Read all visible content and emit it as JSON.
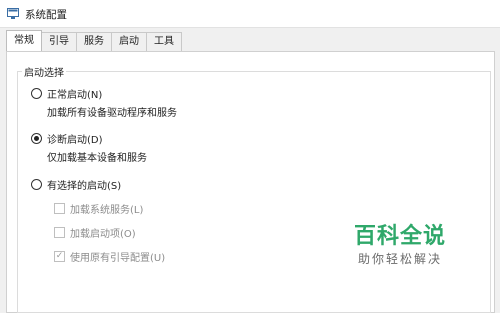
{
  "window": {
    "title": "系统配置"
  },
  "tabs": [
    {
      "label": "常规",
      "active": true
    },
    {
      "label": "引导"
    },
    {
      "label": "服务"
    },
    {
      "label": "启动"
    },
    {
      "label": "工具"
    }
  ],
  "startup_selection": {
    "legend": "启动选择",
    "normal": {
      "label": "正常启动(N)",
      "description": "加载所有设备驱动程序和服务",
      "selected": false
    },
    "diagnostic": {
      "label": "诊断启动(D)",
      "description": "仅加载基本设备和服务",
      "selected": true
    },
    "selective": {
      "label": "有选择的启动(S)",
      "selected": false,
      "options": [
        {
          "label": "加载系统服务(L)",
          "checked": false,
          "enabled": false
        },
        {
          "label": "加载启动项(O)",
          "checked": false,
          "enabled": false
        },
        {
          "label": "使用原有引导配置(U)",
          "checked": true,
          "enabled": false
        }
      ]
    }
  },
  "watermark": {
    "title": "百科全说",
    "subtitle": "助你轻松解决"
  },
  "colors": {
    "watermark_green": "#2fa86a",
    "disabled_text": "#8c8c8c"
  },
  "icons": {
    "app": "msconfig-icon"
  }
}
